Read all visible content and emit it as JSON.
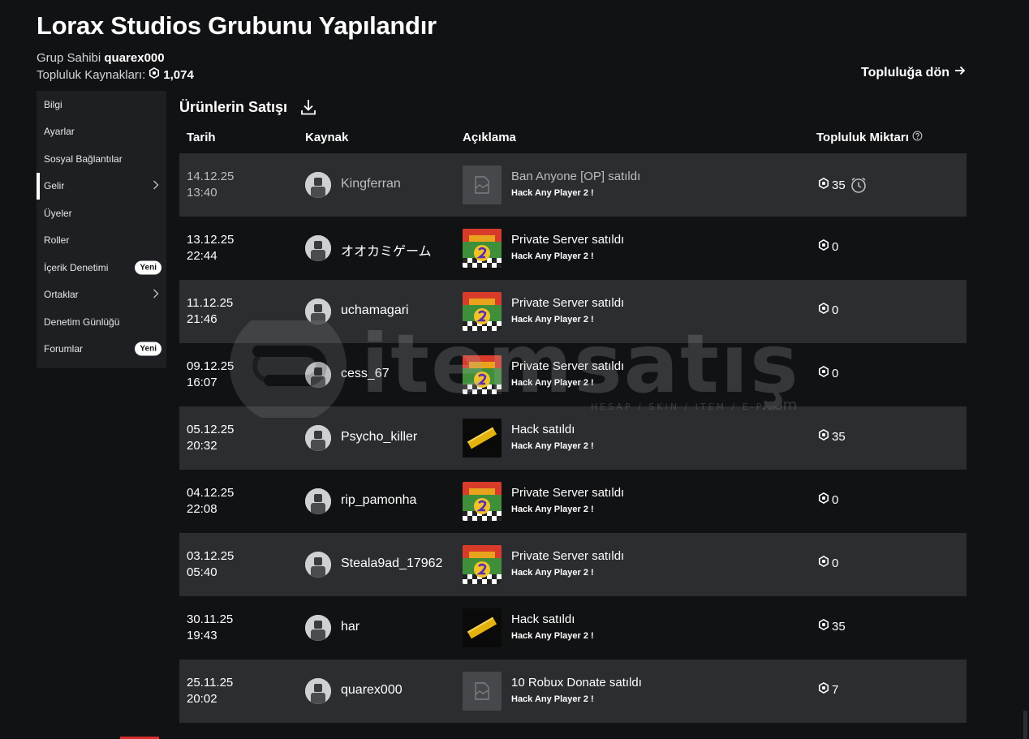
{
  "header": {
    "title": "Lorax Studios Grubunu Yapılandır",
    "owner_label": "Grup Sahibi",
    "owner_name": "quarex000",
    "funds_label": "Topluluk Kaynakları:",
    "funds_value": "1,074",
    "back_link": "Topluluğa dön"
  },
  "sidebar": {
    "items": [
      {
        "label": "Bilgi"
      },
      {
        "label": "Ayarlar"
      },
      {
        "label": "Sosyal Bağlantılar"
      },
      {
        "label": "Gelir"
      },
      {
        "label": "Üyeler"
      },
      {
        "label": "Roller"
      },
      {
        "label": "İçerik Denetimi",
        "badge": "Yeni"
      },
      {
        "label": "Ortaklar"
      },
      {
        "label": "Denetim Günlüğü"
      },
      {
        "label": "Forumlar",
        "badge": "Yeni"
      }
    ]
  },
  "main": {
    "section_title": "Ürünlerin Satışı",
    "columns": {
      "date": "Tarih",
      "source": "Kaynak",
      "description": "Açıklama",
      "amount": "Topluluk Miktarı"
    },
    "rows": [
      {
        "date": "14.12.25",
        "time": "13:40",
        "source": "Kingferran",
        "title": "Ban Anyone [OP] satıldı",
        "subtitle": "Hack Any Player 2 !",
        "amount": "35",
        "thumb": "placeholder",
        "pending": true
      },
      {
        "date": "13.12.25",
        "time": "22:44",
        "source": "オオカミゲーム",
        "title": "Private Server satıldı",
        "subtitle": "Hack Any Player 2 !",
        "amount": "0",
        "thumb": "game"
      },
      {
        "date": "11.12.25",
        "time": "21:46",
        "source": "uchamagari",
        "title": "Private Server satıldı",
        "subtitle": "Hack Any Player 2 !",
        "amount": "0",
        "thumb": "game"
      },
      {
        "date": "09.12.25",
        "time": "16:07",
        "source": "cess_67",
        "title": "Private Server satıldı",
        "subtitle": "Hack Any Player 2 !",
        "amount": "0",
        "thumb": "game"
      },
      {
        "date": "05.12.25",
        "time": "20:32",
        "source": "Psycho_killer",
        "title": "Hack satıldı",
        "subtitle": "Hack Any Player 2 !",
        "amount": "35",
        "thumb": "hack"
      },
      {
        "date": "04.12.25",
        "time": "22:08",
        "source": "rip_pamonha",
        "title": "Private Server satıldı",
        "subtitle": "Hack Any Player 2 !",
        "amount": "0",
        "thumb": "game"
      },
      {
        "date": "03.12.25",
        "time": "05:40",
        "source": "Steala9ad_17962",
        "title": "Private Server satıldı",
        "subtitle": "Hack Any Player 2 !",
        "amount": "0",
        "thumb": "game"
      },
      {
        "date": "30.11.25",
        "time": "19:43",
        "source": "har",
        "title": "Hack satıldı",
        "subtitle": "Hack Any Player 2 !",
        "amount": "35",
        "thumb": "hack"
      },
      {
        "date": "25.11.25",
        "time": "20:02",
        "source": "quarex000",
        "title": "10 Robux Donate satıldı",
        "subtitle": "Hack Any Player 2 !",
        "amount": "7",
        "thumb": "placeholder"
      }
    ]
  },
  "watermark": {
    "brand": "itemsatış",
    "tagline": "HESAP / SKIN / ITEM / E-PIN",
    "suffix": ".com"
  },
  "icons": {
    "robux": "robux-icon",
    "download": "download-icon",
    "arrow": "arrow-right-icon",
    "help": "help-icon",
    "clock": "alarm-clock-icon",
    "chevron": "chevron-right-icon"
  }
}
